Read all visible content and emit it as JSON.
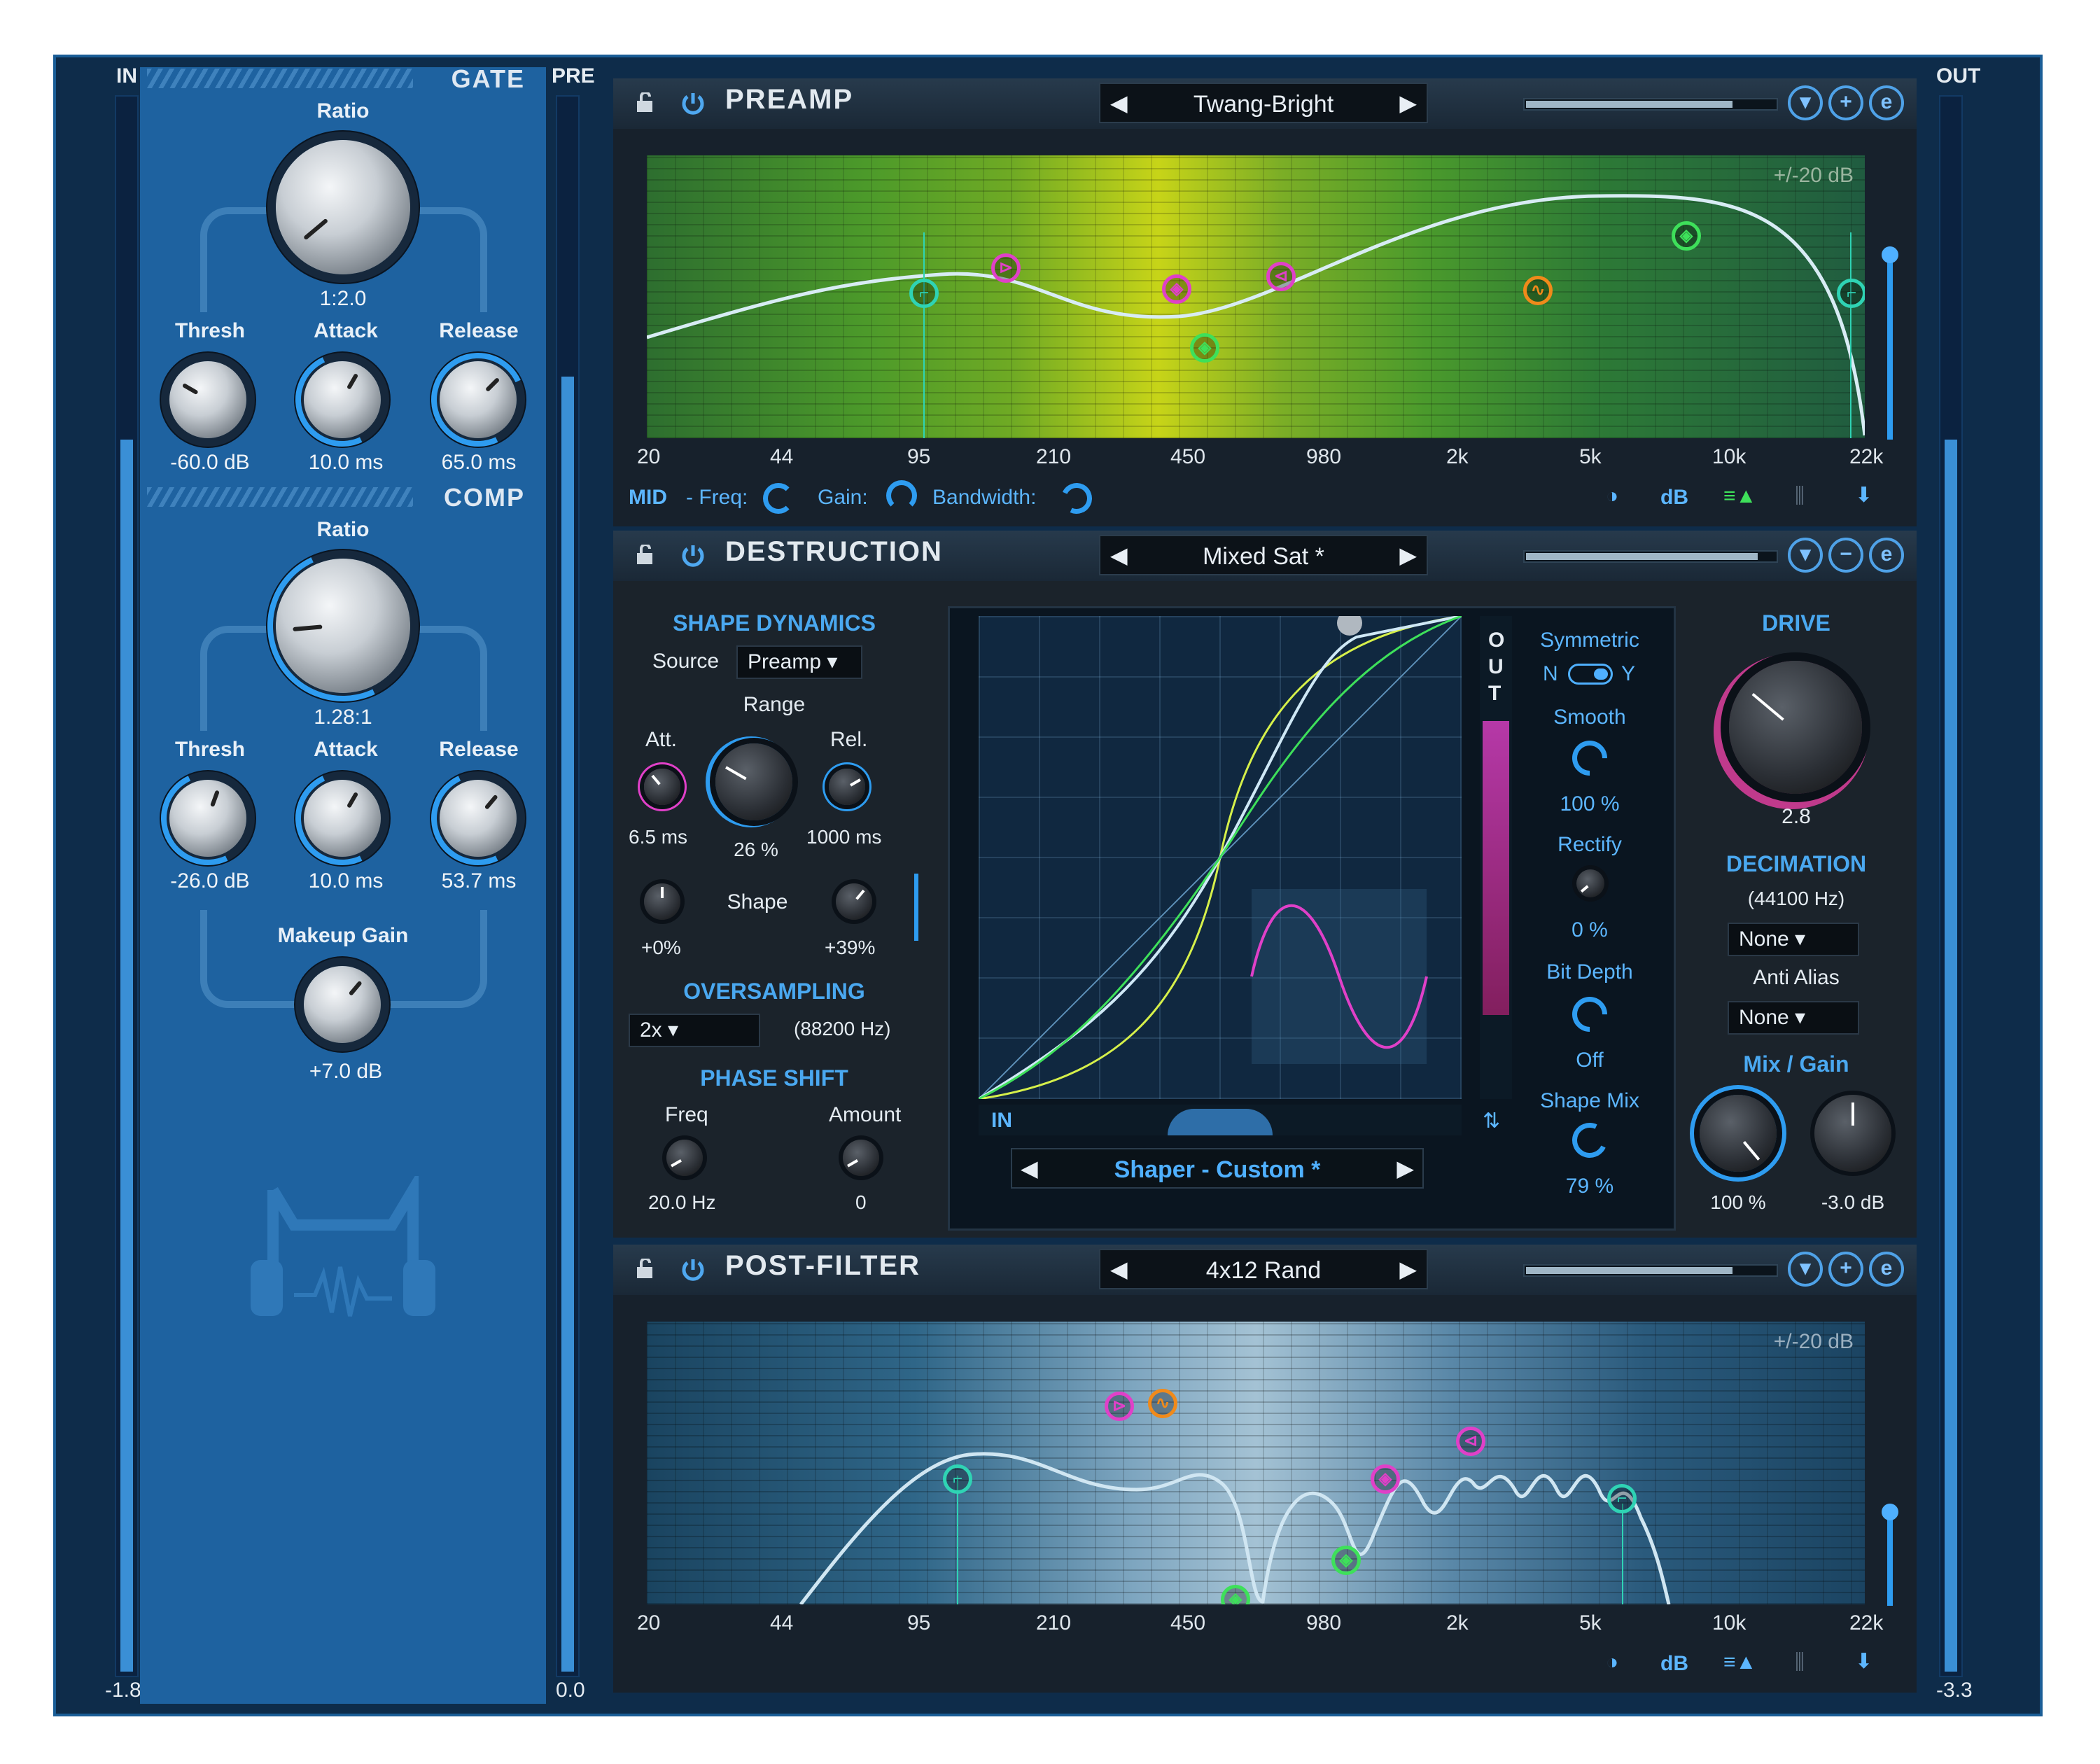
{
  "meters": {
    "in_label": "IN",
    "in_value": "-1.8",
    "pre_label": "PRE",
    "pre_value": "0.0",
    "out_label": "OUT",
    "out_value": "-3.3"
  },
  "gate": {
    "title": "GATE",
    "ratio_label": "Ratio",
    "ratio_value": "1:2.0",
    "thresh_label": "Thresh",
    "thresh_value": "-60.0 dB",
    "attack_label": "Attack",
    "attack_value": "10.0 ms",
    "release_label": "Release",
    "release_value": "65.0 ms"
  },
  "comp": {
    "title": "COMP",
    "ratio_label": "Ratio",
    "ratio_value": "1.28:1",
    "thresh_label": "Thresh",
    "thresh_value": "-26.0 dB",
    "attack_label": "Attack",
    "attack_value": "10.0 ms",
    "release_label": "Release",
    "release_value": "53.7 ms",
    "makeup_label": "Makeup Gain",
    "makeup_value": "+7.0 dB"
  },
  "preamp": {
    "title": "PREAMP",
    "preset": "Twang-Bright",
    "db_range": "+/-20 dB",
    "freq_ticks": [
      "20",
      "44",
      "95",
      "210",
      "450",
      "980",
      "2k",
      "5k",
      "10k",
      "22k"
    ],
    "mid_label": "MID",
    "freq_label": "- Freq:",
    "gain_label": "Gain:",
    "bandwidth_label": "Bandwidth:",
    "db_button": "dB"
  },
  "destruction": {
    "title": "DESTRUCTION",
    "preset": "Mixed Sat *",
    "shape_dynamics": "SHAPE DYNAMICS",
    "source_label": "Source",
    "source_value": "Preamp",
    "range_label": "Range",
    "att_label": "Att.",
    "rel_label": "Rel.",
    "att_value": "6.5 ms",
    "range_value": "26 %",
    "rel_value": "1000 ms",
    "shape_label": "Shape",
    "shape_left_value": "+0%",
    "shape_right_value": "+39%",
    "oversampling": "OVERSAMPLING",
    "os_value": "2x",
    "os_rate": "(88200 Hz)",
    "phase_shift": "PHASE SHIFT",
    "freq_label": "Freq",
    "amount_label": "Amount",
    "freq_value": "20.0  Hz",
    "amount_value": "0",
    "in_label": "IN",
    "out_label": [
      "O",
      "U",
      "T"
    ],
    "shaper_preset": "Shaper - Custom *",
    "symmetric_label": "Symmetric",
    "sym_n": "N",
    "sym_y": "Y",
    "smooth_label": "Smooth",
    "smooth_value": "100 %",
    "rectify_label": "Rectify",
    "rectify_value": "0 %",
    "bitdepth_label": "Bit Depth",
    "bitdepth_value": "Off",
    "shapemix_label": "Shape Mix",
    "shapemix_value": "79 %",
    "drive_label": "DRIVE",
    "drive_value": "2.8",
    "decimation_label": "DECIMATION",
    "decimation_rate": "(44100 Hz)",
    "decimation_value": "None",
    "antialias_label": "Anti Alias",
    "antialias_value": "None",
    "mixgain_label": "Mix  /  Gain",
    "mix_value": "100 %",
    "gain_value": "-3.0 dB"
  },
  "postfilter": {
    "title": "POST-FILTER",
    "preset": "4x12 Rand",
    "db_range": "+/-20 dB",
    "freq_ticks": [
      "20",
      "44",
      "95",
      "210",
      "450",
      "980",
      "2k",
      "5k",
      "10k",
      "22k"
    ],
    "db_button": "dB"
  },
  "colors": {
    "accent": "#2e9cf0",
    "panel_blue": "#1e62a0",
    "band_teal": "#2fd3b4",
    "band_magenta": "#e040c8",
    "band_green": "#3ee05a",
    "band_orange": "#f08a1a"
  }
}
